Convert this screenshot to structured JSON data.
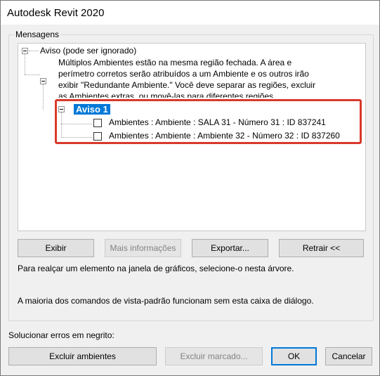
{
  "window": {
    "title": "Autodesk Revit 2020"
  },
  "messages_group": {
    "label": "Mensagens"
  },
  "tree": {
    "root_label": "Aviso (pode ser ignorado)",
    "description_lines": [
      "Múltiplos Ambientes estão na mesma região fechada.  A área e",
      "perímetro corretos serão atribuídos a um Ambiente e os outros irão",
      "exibir \"Redundante Ambiente.\"  Você deve separar as regiões, excluir",
      "as Ambientes extras, ou movê-las para diferentes regiões."
    ],
    "warning_label": "Aviso 1",
    "items": [
      {
        "label": "Ambientes : Ambiente : SALA 31 - Número 31 : ID 837241",
        "checked": false
      },
      {
        "label": "Ambientes : Ambiente : Ambiente 32 - Número 32 : ID 837260",
        "checked": false
      }
    ]
  },
  "action_buttons": {
    "show": "Exibir",
    "more_info": "Mais informações",
    "export": "Exportar...",
    "collapse": "Retrair <<"
  },
  "info": {
    "highlight_hint": "Para realçar um elemento na janela de gráficos, selecione-o nesta árvore.",
    "commands_hint": "A maioria dos comandos de vista-padrão funcionam sem esta caixa de diálogo."
  },
  "resolve": {
    "label": "Solucionar erros em negrito:",
    "delete_rooms": "Excluir ambientes",
    "delete_checked": "Excluir marcado...",
    "ok": "OK",
    "cancel": "Cancelar"
  },
  "colors": {
    "selection": "#0078d7",
    "highlight_box": "#d9392b"
  }
}
